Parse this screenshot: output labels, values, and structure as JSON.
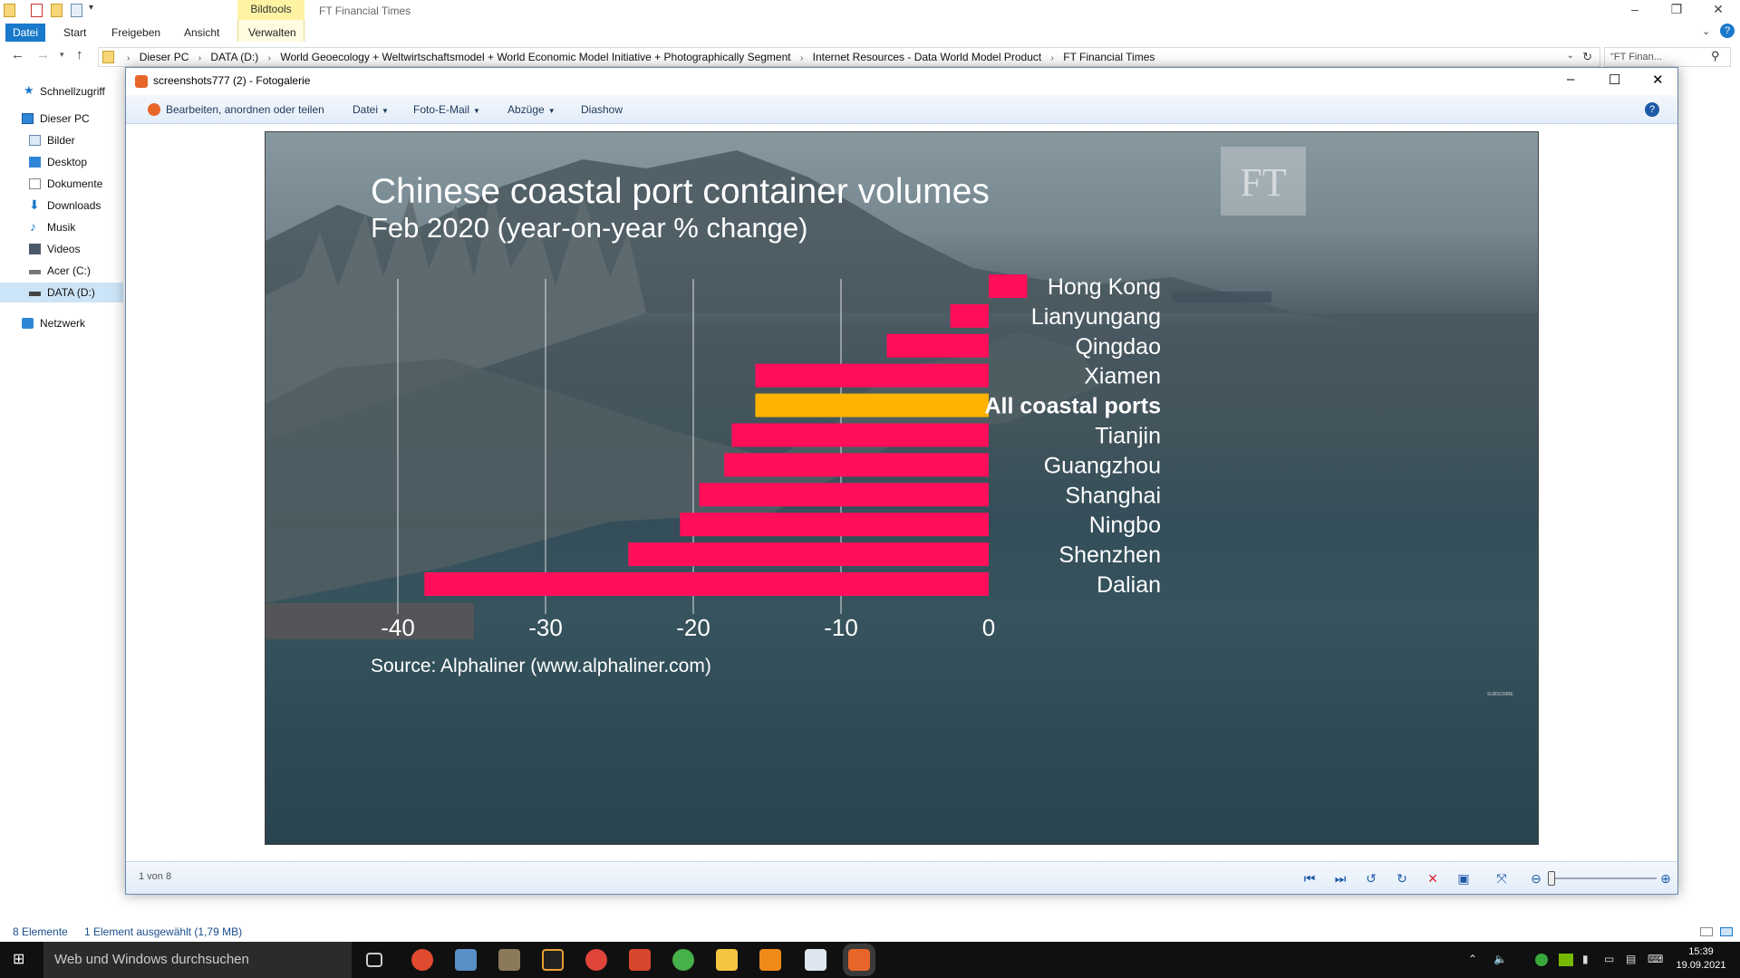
{
  "explorer": {
    "ribbon_context_label": "Bildtools",
    "window_caption": "FT Financial  Times",
    "tabs": [
      "Datei",
      "Start",
      "Freigeben",
      "Ansicht",
      "Verwalten"
    ],
    "breadcrumb": [
      "Dieser PC",
      "DATA (D:)",
      "World Geoecology + Weltwirtschaftsmodel + World Economic Model  Initiative + Photographically Segment",
      "Internet Resources - Data World Model Product",
      "FT Financial  Times"
    ],
    "search_placeholder": "\"FT Finan...",
    "nav_items": [
      {
        "label": "Schnellzugriff",
        "icon": "star-icon"
      },
      {
        "label": "Dieser PC",
        "icon": "computer-icon"
      },
      {
        "label": "Bilder",
        "icon": "pictures-folder-icon"
      },
      {
        "label": "Desktop",
        "icon": "desktop-folder-icon"
      },
      {
        "label": "Dokumente",
        "icon": "documents-folder-icon"
      },
      {
        "label": "Downloads",
        "icon": "download-arrow-icon"
      },
      {
        "label": "Musik",
        "icon": "music-note-icon"
      },
      {
        "label": "Videos",
        "icon": "video-folder-icon"
      },
      {
        "label": "Acer (C:)",
        "icon": "drive-icon"
      },
      {
        "label": "DATA (D:)",
        "icon": "drive-icon"
      },
      {
        "label": "Netzwerk",
        "icon": "network-icon"
      }
    ],
    "status_items_count": "8 Elemente",
    "status_selection": "1 Element ausgewählt (1,79 MB)"
  },
  "gallery": {
    "title": "screenshots777 (2) - Fotogalerie",
    "toolbar": {
      "edit": "Bearbeiten, anordnen oder teilen",
      "file": "Datei",
      "photo_email": "Foto-E-Mail",
      "prints": "Abzüge",
      "slideshow": "Diashow"
    },
    "counter": "1 von 8"
  },
  "photo": {
    "logo": "FT",
    "subscribe_text": "SUBSCRIBE",
    "colors": {
      "ports": "#ff0e5a",
      "all_ports": "#ffb200",
      "text": "#ffffff"
    }
  },
  "chart_data": {
    "type": "bar",
    "orientation": "horizontal",
    "title": "Chinese coastal port container volumes",
    "subtitle": "Feb 2020 (year-on-year % change)",
    "source": "Source: Alphaliner (www.alphaliner.com)",
    "categories": [
      "Hong Kong",
      "Lianyungang",
      "Qingdao",
      "Xiamen",
      "All coastal ports",
      "Tianjin",
      "Guangzhou",
      "Shanghai",
      "Ningbo",
      "Shenzhen",
      "Dalian"
    ],
    "values": [
      2.6,
      -2.6,
      -6.9,
      -15.8,
      -15.8,
      -17.4,
      -17.9,
      -19.6,
      -20.9,
      -24.4,
      -38.2
    ],
    "highlight": "All coastal ports",
    "xlim": [
      -40,
      0
    ],
    "xticks": [
      "-40",
      "-30",
      "-20",
      "-10",
      "0"
    ],
    "grid": true
  },
  "taskbar": {
    "search_placeholder": "Web und Windows durchsuchen",
    "time": "15:39",
    "date": "19.09.2021"
  }
}
